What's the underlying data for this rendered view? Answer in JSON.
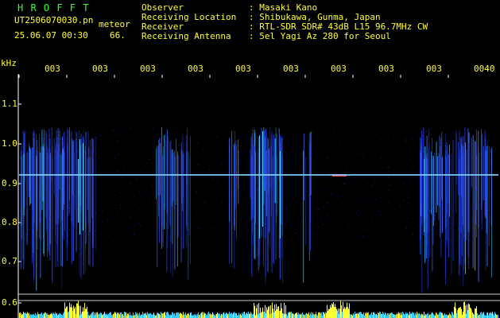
{
  "app": {
    "title": "H R O F F T"
  },
  "file": {
    "name": "UT2506070030.pn",
    "mode": "meteor",
    "date_time": "25.06.07 00:30",
    "count": "66."
  },
  "header": {
    "labels": [
      "Observer",
      "Receiving Location",
      "Receiver",
      "Receiving Antenna"
    ],
    "values": [
      ": Masaki Kano",
      ": Shibukawa, Gunma, Japan",
      ": RTL-SDR SDR# 43dB L15 96.7MHz CW",
      ": 5el Yagi Az 280 for Seoul"
    ]
  },
  "axis": {
    "unit": "kHz",
    "y_ticks": [
      "1.1",
      "1.0",
      "0.9",
      "0.8",
      "0.7",
      "0.6"
    ],
    "x_ticks": [
      "003",
      "003",
      "003",
      "003",
      "003",
      "003",
      "003",
      "003",
      "003",
      "0040"
    ]
  },
  "colors": {
    "text": "#ffff33",
    "title": "#33ff33",
    "grid": "#ffffff",
    "signal": "#2f4fff",
    "carrier": "#7fd0ff"
  }
}
